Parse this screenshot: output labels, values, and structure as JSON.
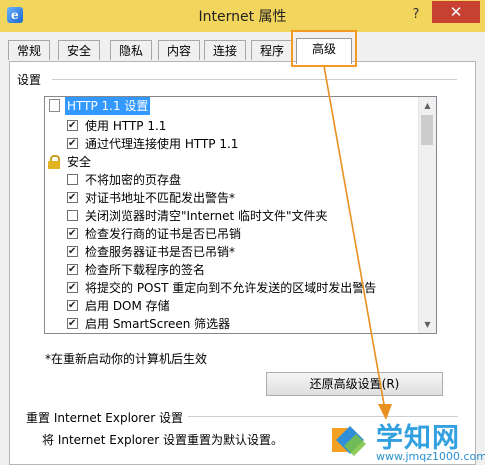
{
  "window": {
    "title": "Internet 属性",
    "help": "?",
    "close": "✕"
  },
  "tabs": [
    {
      "label": "常规"
    },
    {
      "label": "安全"
    },
    {
      "label": "隐私"
    },
    {
      "label": "内容"
    },
    {
      "label": "连接"
    },
    {
      "label": "程序"
    },
    {
      "label": "高级"
    }
  ],
  "active_tab": "高级",
  "settings": {
    "group_label": "设置",
    "items": [
      {
        "type": "category",
        "icon": "document-icon",
        "label": "HTTP 1.1 设置",
        "selected": true
      },
      {
        "type": "checkbox",
        "label": "使用 HTTP 1.1",
        "checked": true
      },
      {
        "type": "checkbox",
        "label": "通过代理连接使用 HTTP 1.1",
        "checked": true
      },
      {
        "type": "category",
        "icon": "lock-icon",
        "label": "安全",
        "selected": false
      },
      {
        "type": "checkbox",
        "label": "不将加密的页存盘",
        "checked": false
      },
      {
        "type": "checkbox",
        "label": "对证书地址不匹配发出警告*",
        "checked": true
      },
      {
        "type": "checkbox",
        "label": "关闭浏览器时清空\"Internet 临时文件\"文件夹",
        "checked": false
      },
      {
        "type": "checkbox",
        "label": "检查发行商的证书是否已吊销",
        "checked": true
      },
      {
        "type": "checkbox",
        "label": "检查服务器证书是否已吊销*",
        "checked": true
      },
      {
        "type": "checkbox",
        "label": "检查所下载程序的签名",
        "checked": true
      },
      {
        "type": "checkbox",
        "label": "将提交的 POST 重定向到不允许发送的区域时发出警告",
        "checked": true
      },
      {
        "type": "checkbox",
        "label": "启用 DOM 存储",
        "checked": true
      },
      {
        "type": "checkbox",
        "label": "启用 SmartScreen 筛选器",
        "checked": true
      }
    ],
    "note": "*在重新启动你的计算机后生效",
    "restore_button": "还原高级设置(R)"
  },
  "reset": {
    "group_label": "重置 Internet Explorer 设置",
    "description": "将 Internet Explorer 设置重置为默认设置。"
  },
  "watermark": {
    "main": "学知网",
    "sub": "www.jmqz1000.com"
  },
  "colors": {
    "titlebar": "#f2d55c",
    "close": "#c84031",
    "highlight": "#f39a25",
    "selection": "#3399ff"
  }
}
